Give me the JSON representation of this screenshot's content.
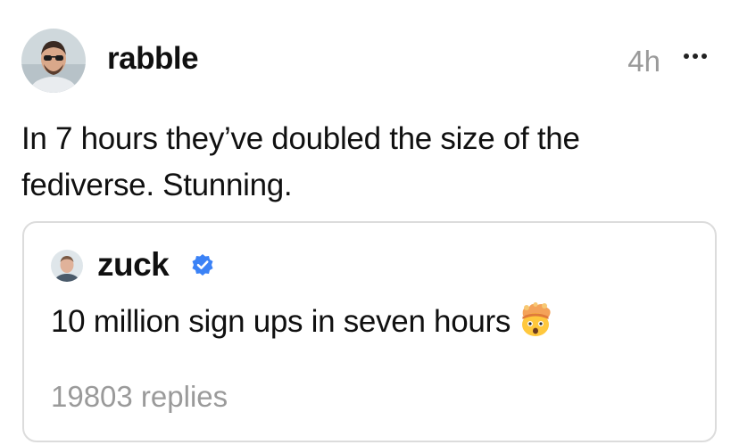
{
  "post": {
    "username": "rabble",
    "time": "4h",
    "text": "In 7 hours they’ve doubled the size of the fediverse. Stunning.",
    "avatar_icon": "profile-photo-man-sunglasses",
    "more_icon": "ellipsis-icon"
  },
  "quote": {
    "username": "zuck",
    "verified": true,
    "verified_color": "#3b82f6",
    "text": "10 million sign ups in seven hours",
    "emoji_icon": "exploding-head-emoji",
    "replies": "19803 replies"
  },
  "colors": {
    "text": "#101010",
    "muted": "#9a9a9a",
    "card_border": "#dcdcdc"
  }
}
